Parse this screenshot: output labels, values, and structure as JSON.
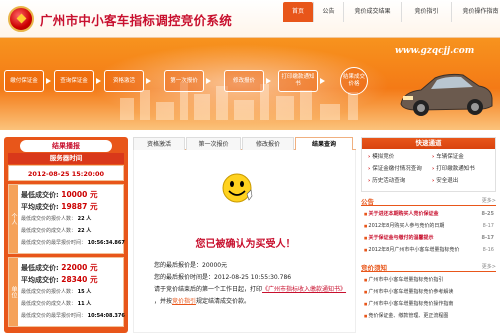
{
  "header": {
    "title": "广州市中小客车指标调控竞价系统",
    "nav": [
      {
        "label": "首页"
      },
      {
        "label": "公告"
      },
      {
        "label": "竞价成交结果"
      },
      {
        "label": "竞价指引"
      },
      {
        "label": "竞价操作指南"
      }
    ]
  },
  "banner": {
    "url": "www.gzqcjj.com",
    "steps": [
      "缴付保证金",
      "查询保证金",
      "资格激活",
      "第一次报价",
      "修改报价",
      "打印缴款通知书",
      "结果成交价格"
    ]
  },
  "left": {
    "title": "结果播报",
    "time_label": "服务器时间",
    "time": "2012-08-25 15:20:00",
    "blocks": [
      {
        "side": "个人",
        "lowest_label": "最低成交价:",
        "lowest": "10000 元",
        "avg_label": "平均成交价:",
        "avg": "19887 元",
        "rows": [
          {
            "label": "最低成交价的报价人数：",
            "value": "22 人"
          },
          {
            "label": "最低成交价的成交人数：",
            "value": "22 人"
          },
          {
            "label": "最低成交价的最早报价时间：",
            "value": "10:56:34.867"
          }
        ]
      },
      {
        "side": "单位",
        "lowest_label": "最低成交价:",
        "lowest": "22000 元",
        "avg_label": "平均成交价:",
        "avg": "28340 元",
        "rows": [
          {
            "label": "最低成交价的报价人数：",
            "value": "15 人"
          },
          {
            "label": "最低成交价的成交人数：",
            "value": "11 人"
          },
          {
            "label": "最低成交价的最早报价时间：",
            "value": "10:54:08.376"
          }
        ]
      }
    ]
  },
  "center": {
    "tabs": [
      "资格激活",
      "第一次报价",
      "修改报价",
      "结果查询"
    ],
    "confirm": "您已被确认为买受人！",
    "last_price": "您的最后报价是：20000元",
    "last_time": "您的最后报价时间是：2012-08-25 10:55:30.786",
    "notice_a": "请于竞价结束后的第一个工作日起，打印",
    "notice_link": "《广州市指标收入缴款通知书》",
    "notice_b": "，并按",
    "notice_link2": "竞价指引",
    "notice_c": "规定结清成交价款。"
  },
  "right": {
    "quick_title": "快速通道",
    "quick_links": [
      "模拟竞价",
      "车辆保证金",
      "保证金缴付情况查询",
      "打印缴款通知书",
      "历史活动查询",
      "安全退出"
    ],
    "notice_title": "公告",
    "more": "更多>",
    "notices": [
      {
        "text": "关于进还本期购买人竞价保证金",
        "date": "8-25",
        "red": true
      },
      {
        "text": "2012年8月购买人参与竞价的日期",
        "date": "8-17",
        "red": false
      },
      {
        "text": "关于保证金与缴付的温馨提示",
        "date": "8-17",
        "red": true
      },
      {
        "text": "2012年8月广州市中小客车增量指标竞价",
        "date": "8-16",
        "red": false
      }
    ],
    "guide_title": "竞价须知",
    "guides": [
      "广州市中小客车增量指标竞价指引",
      "广州市中小客车增量指标竞价参考解读",
      "广州市中小客车增量指标竞价操作指南",
      "竞价保证金、缴款管理、更正流程图"
    ]
  },
  "colors": {
    "accent": "#e8561a",
    "red": "#c8102e"
  }
}
